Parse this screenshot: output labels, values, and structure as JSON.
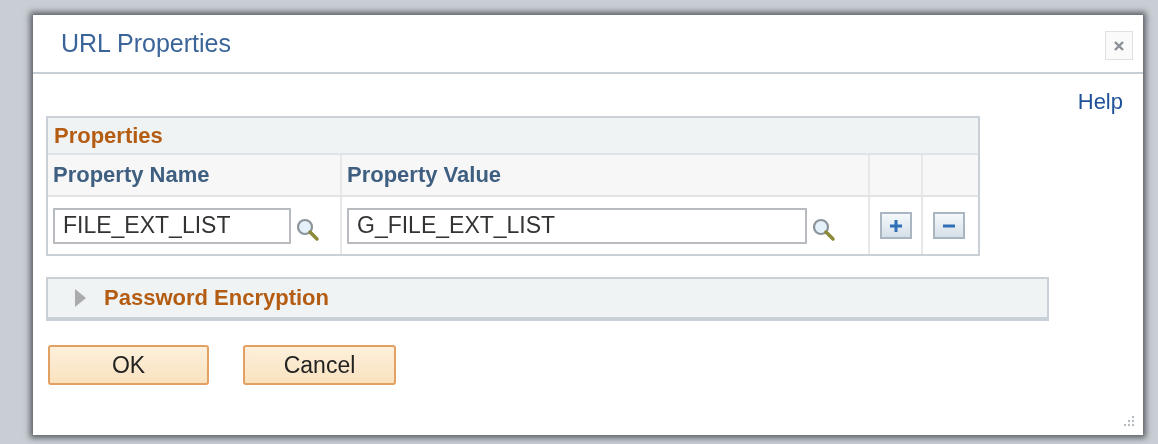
{
  "dialog": {
    "title": "URL Properties",
    "help_link": "Help"
  },
  "properties_grid": {
    "title": "Properties",
    "columns": [
      "Property Name",
      "Property Value"
    ],
    "rows": [
      {
        "name": "FILE_EXT_LIST",
        "value": "G_FILE_EXT_LIST"
      }
    ]
  },
  "sections": [
    {
      "title": "Password Encryption",
      "expanded": false
    }
  ],
  "buttons": [
    "OK",
    "Cancel"
  ]
}
